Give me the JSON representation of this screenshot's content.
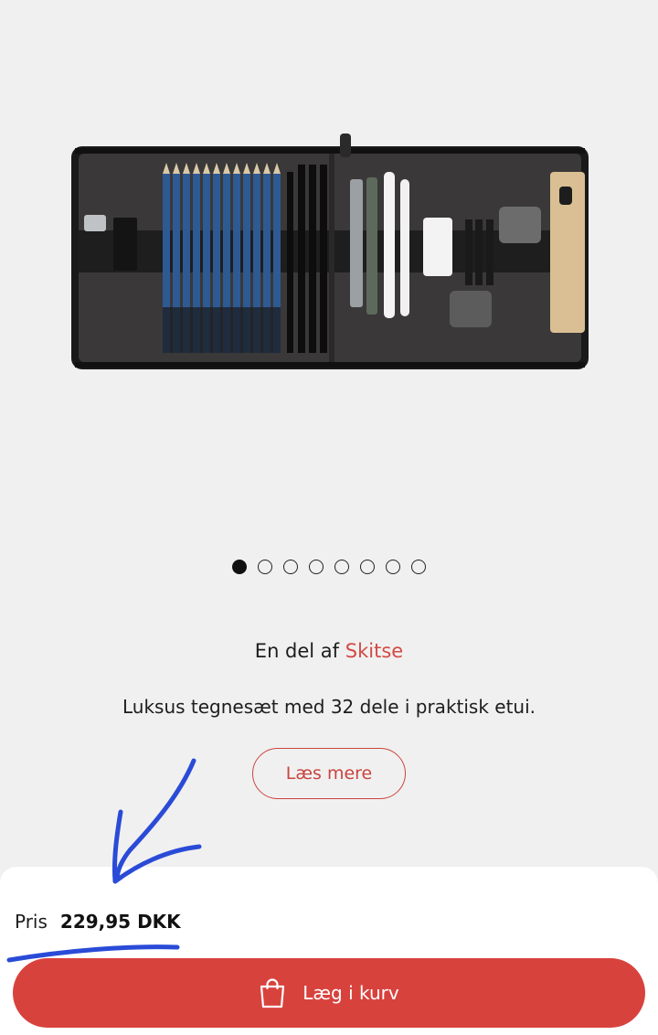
{
  "product": {
    "image_alt": "Pencil drawing set in black zip case",
    "carousel": {
      "total": 8,
      "active_index": 0
    }
  },
  "collection": {
    "prefix": "En del af",
    "link_label": "Skitse"
  },
  "description": "Luksus tegnesæt med 32 dele i praktisk etui.",
  "read_more_label": "Læs mere",
  "price": {
    "label": "Pris",
    "value": "229,95 DKK"
  },
  "add_to_cart": {
    "label": "Læg i kurv",
    "icon": "shopping-bag-icon"
  },
  "colors": {
    "accent": "#d8423d",
    "background": "#f1f0f0",
    "annotation": "#2a4bd7"
  }
}
